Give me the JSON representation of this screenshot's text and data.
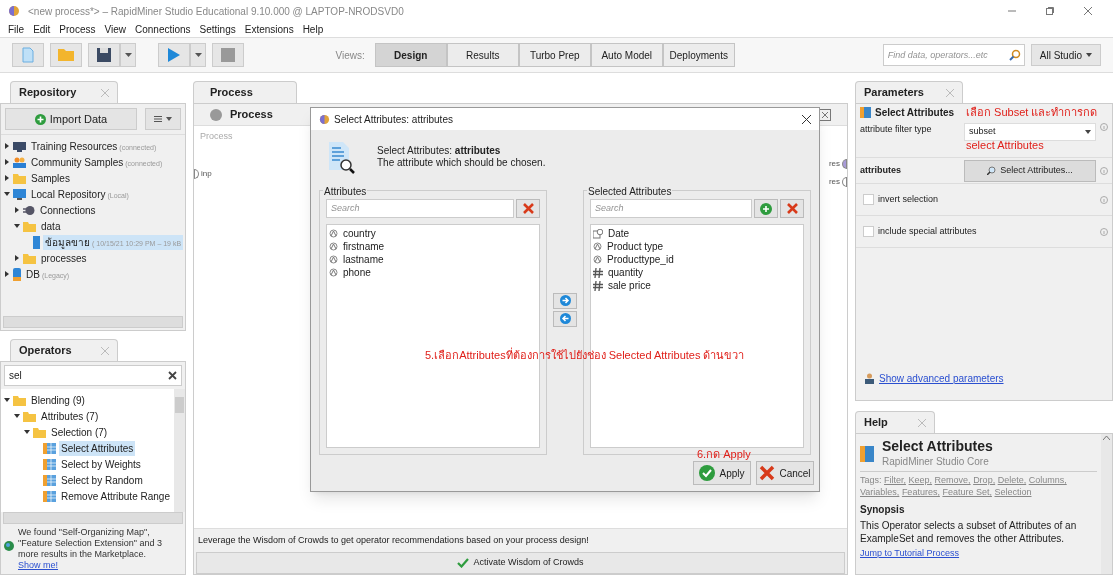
{
  "window": {
    "title": "<new process*> – RapidMiner Studio Educational 9.10.000 @ LAPTOP-NRODSVD0"
  },
  "menu": [
    "File",
    "Edit",
    "Process",
    "View",
    "Connections",
    "Settings",
    "Extensions",
    "Help"
  ],
  "toolbar": {
    "views_label": "Views:",
    "views": [
      {
        "label": "Design",
        "selected": true
      },
      {
        "label": "Results",
        "selected": false
      },
      {
        "label": "Turbo Prep",
        "selected": false
      },
      {
        "label": "Auto Model",
        "selected": false
      },
      {
        "label": "Deployments",
        "selected": false
      }
    ],
    "search": {
      "placeholder": "Find data, operators...etc"
    },
    "scope": "All Studio"
  },
  "repository": {
    "title": "Repository",
    "import_button": "Import Data",
    "tree": [
      {
        "label": "Training Resources",
        "note": "(connected)",
        "kind": "training",
        "expanded": false
      },
      {
        "label": "Community Samples",
        "note": "(connected)",
        "kind": "community",
        "expanded": false
      },
      {
        "label": "Samples",
        "kind": "folder",
        "expanded": false
      },
      {
        "label": "Local Repository",
        "note": "(Local)",
        "kind": "repository",
        "expanded": true,
        "children": [
          {
            "label": "Connections",
            "kind": "connections",
            "expanded": false
          },
          {
            "label": "data",
            "kind": "folder",
            "expanded": true,
            "children": [
              {
                "label": "ข้อมูลขาย",
                "note": "( 10/15/21 10:29 PM – 19 kB",
                "kind": "data",
                "selected": true
              }
            ]
          },
          {
            "label": "processes",
            "kind": "folder",
            "expanded": false
          }
        ]
      },
      {
        "label": "DB",
        "note": "(Legacy)",
        "kind": "database",
        "expanded": false
      }
    ]
  },
  "operators": {
    "title": "Operators",
    "search": {
      "value": "sel"
    },
    "tree": [
      {
        "label": "Blending (9)",
        "kind": "folder",
        "expanded": true,
        "children": [
          {
            "label": "Attributes (7)",
            "kind": "folder",
            "expanded": true,
            "children": [
              {
                "label": "Selection (7)",
                "kind": "folder",
                "expanded": true,
                "children": [
                  {
                    "label": "Select Attributes",
                    "kind": "operator",
                    "selected": true
                  },
                  {
                    "label": "Select by Weights",
                    "kind": "operator",
                    "selected": false
                  },
                  {
                    "label": "Select by Random",
                    "kind": "operator",
                    "selected": false
                  },
                  {
                    "label": "Remove Attribute Range",
                    "kind": "operator",
                    "selected": false
                  }
                ]
              }
            ]
          }
        ]
      }
    ],
    "marketplace": {
      "text": "We found \"Self-Organizing Map\", \"Feature Selection Extension\" and 3 more results in the Marketplace.",
      "link": "Show me!"
    }
  },
  "process": {
    "tab": "Process",
    "breadcrumb": "Process",
    "canvas_label": "Process",
    "input_port": "inp",
    "output_ports": [
      "res",
      "res"
    ],
    "wisdom": {
      "text": "Leverage the Wisdom of Crowds to get operator recommendations based on your process design!",
      "button": "Activate Wisdom of Crowds"
    }
  },
  "dialog": {
    "title": "Select Attributes: attributes",
    "heading": "Select Attributes: **attributes**",
    "description": "The attribute which should be chosen.",
    "available": {
      "title": "Attributes",
      "search": {
        "placeholder": "Search"
      },
      "items": [
        {
          "label": "country",
          "kind": "nominal"
        },
        {
          "label": "firstname",
          "kind": "nominal"
        },
        {
          "label": "lastname",
          "kind": "nominal"
        },
        {
          "label": "phone",
          "kind": "nominal"
        }
      ]
    },
    "selected": {
      "title": "Selected Attributes",
      "search": {
        "placeholder": "Search"
      },
      "items": [
        {
          "label": "Date",
          "kind": "date"
        },
        {
          "label": "Product type",
          "kind": "nominal"
        },
        {
          "label": "Producttype_id",
          "kind": "nominal"
        },
        {
          "label": "quantity",
          "kind": "numeric"
        },
        {
          "label": "sale price",
          "kind": "numeric"
        }
      ]
    },
    "buttons": [
      "Apply",
      "Cancel"
    ]
  },
  "parameters": {
    "title": "Parameters",
    "operator": "Select Attributes",
    "rows": [
      {
        "kind": "dropdown",
        "label": "attribute filter type",
        "value": "subset"
      },
      {
        "kind": "button",
        "label": "attributes",
        "value": "Select Attributes..."
      },
      {
        "kind": "checkbox",
        "label": "invert selection",
        "checked": false
      },
      {
        "kind": "checkbox",
        "label": "include special attributes",
        "checked": false
      }
    ],
    "advanced_link": "Show advanced parameters"
  },
  "help": {
    "title": "Help",
    "operator": "Select Attributes",
    "subtitle": "RapidMiner Studio Core",
    "tags_label": "Tags:",
    "tags": [
      "Filter,",
      "Keep,",
      "Remove,",
      "Drop,",
      "Delete,",
      "Columns,",
      "Variables,",
      "Features,",
      "Feature Set,",
      "Selection"
    ],
    "synopsis_title": "Synopsis",
    "synopsis": "This Operator selects a subset of Attributes of an ExampleSet and removes the other Attributes.",
    "link": "Jump to Tutorial Process"
  },
  "annotations": [
    {
      "kind": "attributes",
      "text": "5.เลือกAttributesที่ต้องการใช้ไปยังช่อง Selected Attributes ด้านขวา"
    },
    {
      "kind": "apply",
      "text": "6.กด Apply"
    },
    {
      "kind": "subset",
      "text": "เลือก Subset และทำการกด"
    },
    {
      "kind": "subset_continued",
      "text": "select Attributes"
    }
  ]
}
